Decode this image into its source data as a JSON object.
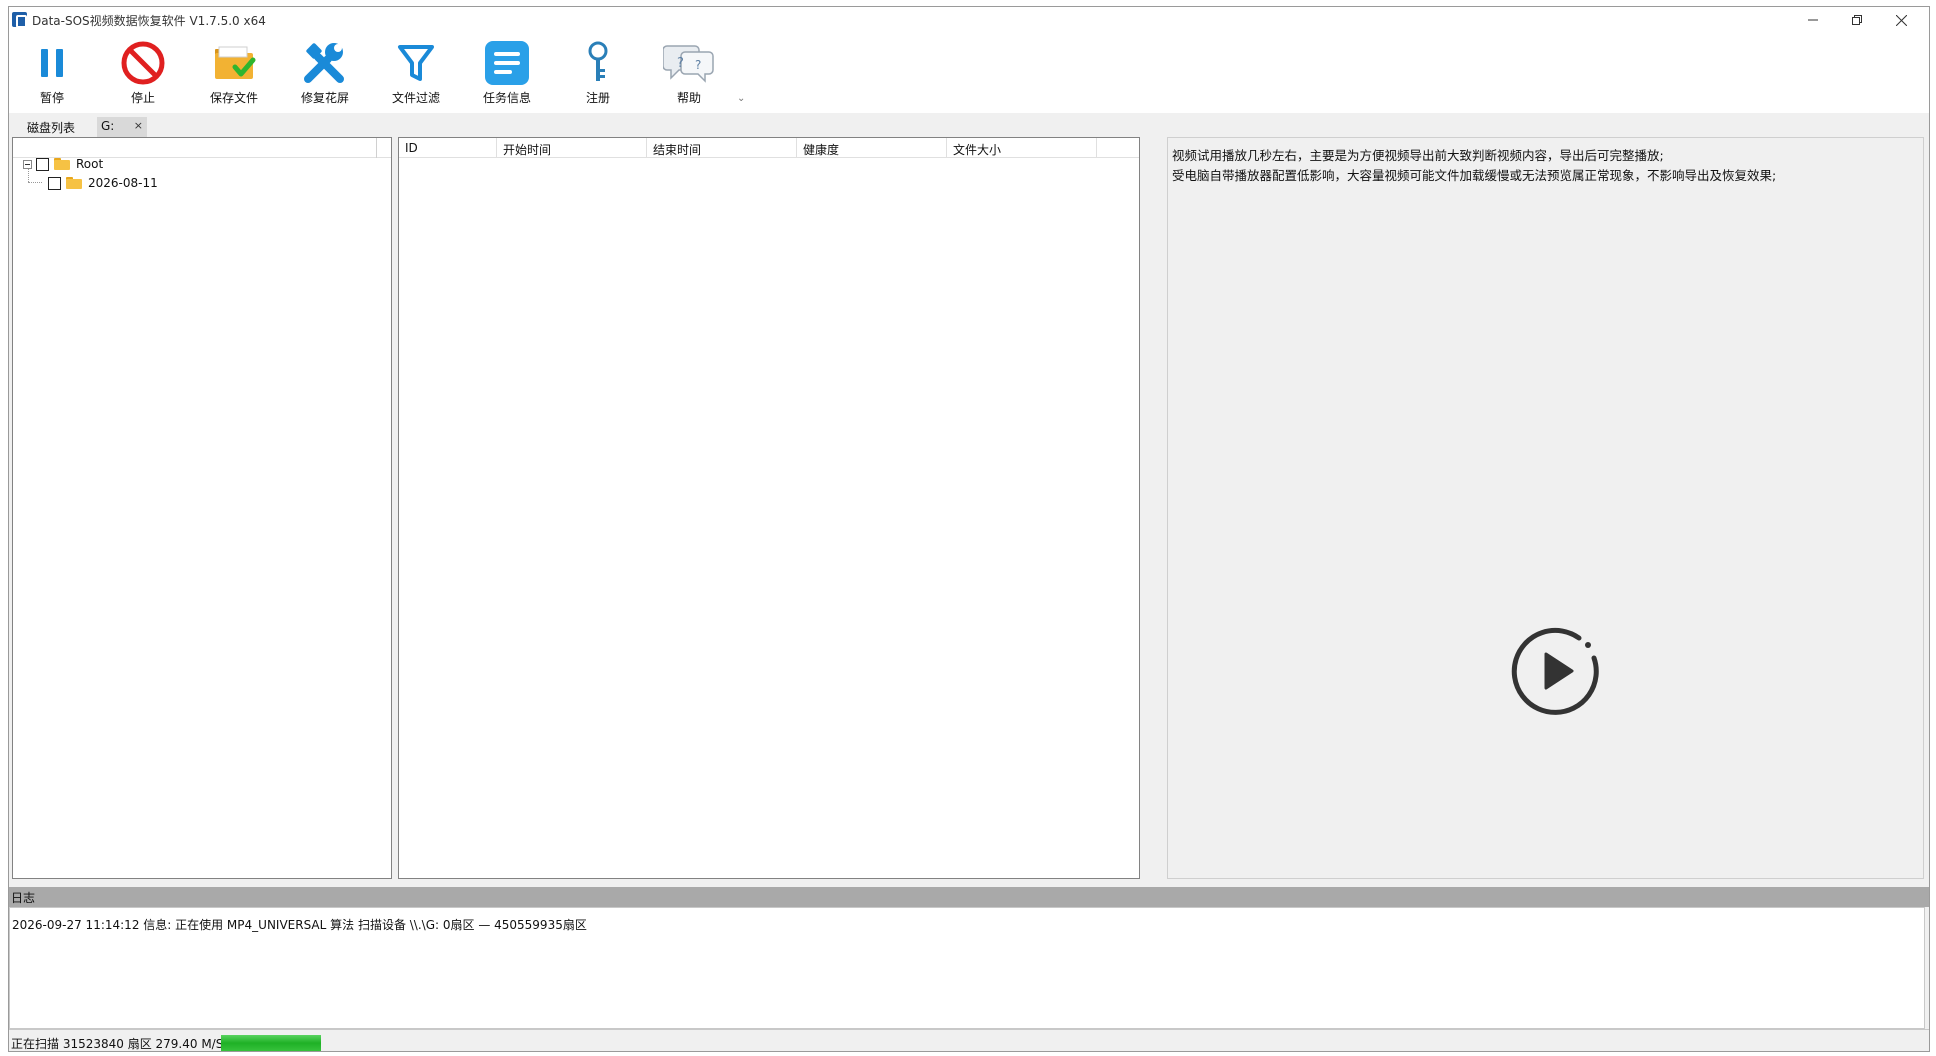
{
  "window": {
    "title": "Data-SOS视频数据恢复软件 V1.7.5.0 x64"
  },
  "toolbar": {
    "items": [
      {
        "label": "暂停",
        "icon": "pause-icon",
        "color": "#1a8ad8"
      },
      {
        "label": "停止",
        "icon": "stop-icon",
        "color": "#e02020"
      },
      {
        "label": "保存文件",
        "icon": "save-folder-icon",
        "color": "#f2b233"
      },
      {
        "label": "修复花屏",
        "icon": "repair-tools-icon",
        "color": "#1a8ad8"
      },
      {
        "label": "文件过滤",
        "icon": "filter-icon",
        "color": "#1a8ad8"
      },
      {
        "label": "任务信息",
        "icon": "task-info-icon",
        "color": "#2aa0e8"
      },
      {
        "label": "注册",
        "icon": "key-icon",
        "color": "#2a7fb8"
      },
      {
        "label": "帮助",
        "icon": "help-icon",
        "color": "#7f8c99"
      }
    ],
    "more_glyph": "⌄"
  },
  "tabs": {
    "disk_list": "磁盘列表",
    "drive": "G:",
    "close": "×"
  },
  "tree": {
    "root": {
      "label": "Root",
      "checked": false,
      "expanded": true
    },
    "children": [
      {
        "label": "2026-08-11",
        "checked": false
      }
    ]
  },
  "list": {
    "columns": [
      "ID",
      "开始时间",
      "结束时间",
      "健康度",
      "文件大小"
    ],
    "rows": []
  },
  "preview": {
    "lines": [
      "视频试用播放几秒左右，主要是为方便视频导出前大致判断视频内容，导出后可完整播放;",
      "受电脑自带播放器配置低影响，大容量视频可能文件加载缓慢或无法预览属正常现象，不影响导出及恢复效果;"
    ],
    "play_icon": "play-circle-icon"
  },
  "log": {
    "title": "日志",
    "entries": [
      "2026-09-27 11:14:12 信息: 正在使用 MP4_UNIVERSAL 算法 扫描设备 \\\\.\\G: 0扇区 — 450559935扇区"
    ]
  },
  "status": {
    "text": "正在扫描 31523840 扇区 279.40 M/S 6%",
    "progress_fraction": 1.0
  },
  "colors": {
    "accent": "#1a8ad8",
    "progress": "#1fb126",
    "log_bar": "#a9a9a9"
  }
}
